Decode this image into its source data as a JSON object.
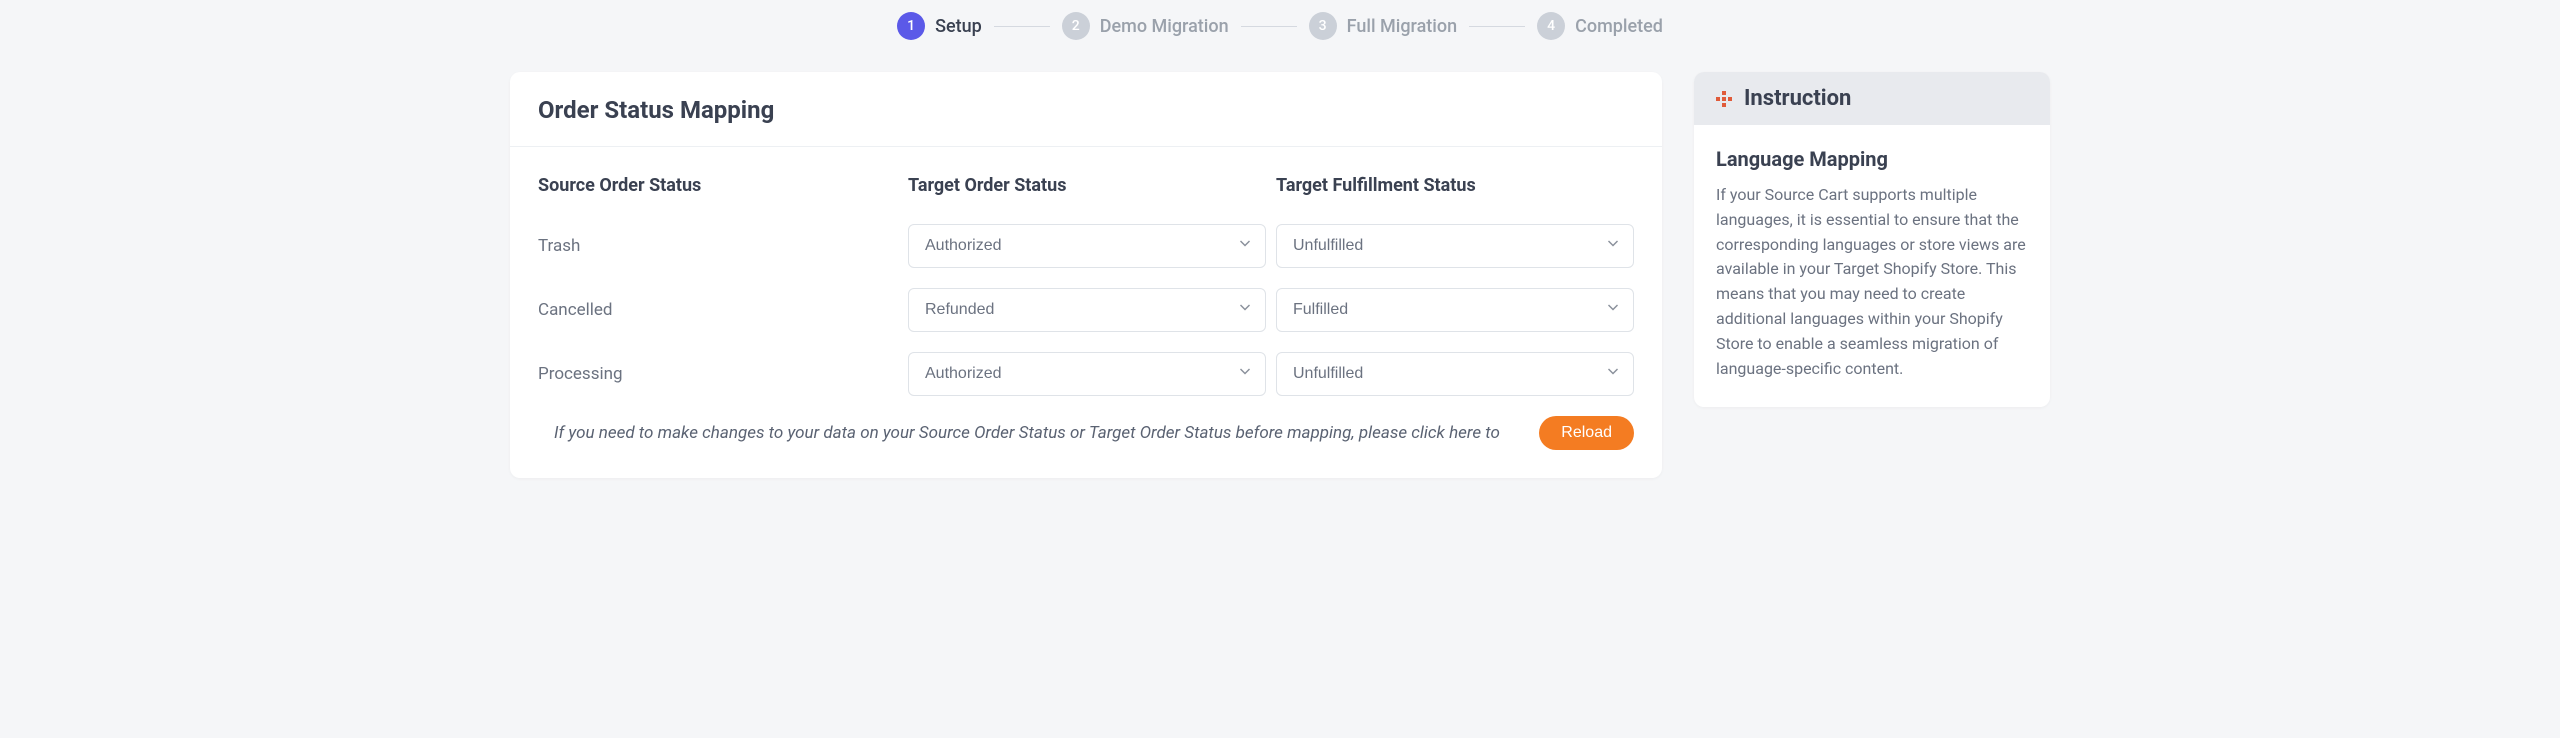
{
  "stepper": {
    "steps": [
      {
        "num": "1",
        "label": "Setup",
        "active": true
      },
      {
        "num": "2",
        "label": "Demo Migration",
        "active": false
      },
      {
        "num": "3",
        "label": "Full Migration",
        "active": false
      },
      {
        "num": "4",
        "label": "Completed",
        "active": false
      }
    ]
  },
  "main": {
    "title": "Order Status Mapping",
    "columns": {
      "source": "Source Order Status",
      "target_order": "Target Order Status",
      "target_fulfillment": "Target Fulfillment Status"
    },
    "rows": [
      {
        "source": "Trash",
        "target_order": "Authorized",
        "target_fulfillment": "Unfulfilled"
      },
      {
        "source": "Cancelled",
        "target_order": "Refunded",
        "target_fulfillment": "Fulfilled"
      },
      {
        "source": "Processing",
        "target_order": "Authorized",
        "target_fulfillment": "Unfulfilled"
      }
    ],
    "footer_note": "If you need to make changes to your data on your Source Order Status or Target Order Status before mapping, please click here to",
    "reload_label": "Reload"
  },
  "sidebar": {
    "title": "Instruction",
    "subheading": "Language Mapping",
    "text": "If your Source Cart supports multiple languages, it is essential to ensure that the corresponding languages or store views are available in your Target Shopify Store. This means that you may need to create additional languages within your Shopify Store to enable a seamless migration of language-specific content."
  }
}
